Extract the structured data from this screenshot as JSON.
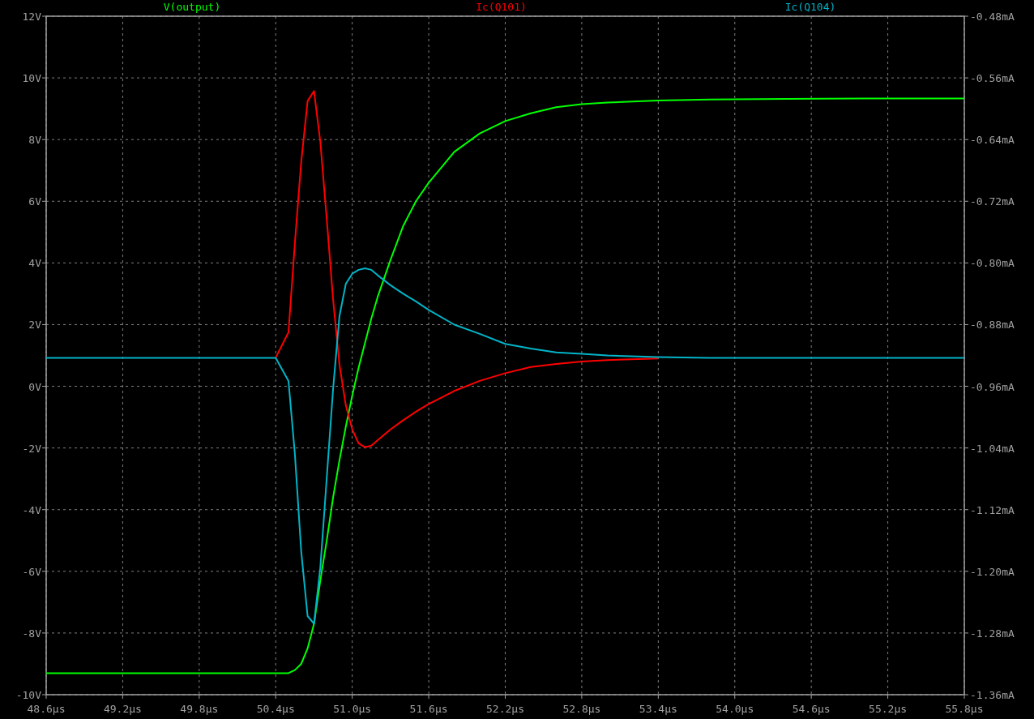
{
  "chart_data": {
    "type": "line",
    "grid": true,
    "x": [
      48.6,
      50.4,
      50.5,
      50.55,
      50.6,
      50.65,
      50.7,
      50.75,
      50.8,
      50.85,
      50.9,
      50.95,
      51.0,
      51.05,
      51.1,
      51.15,
      51.2,
      51.3,
      51.4,
      51.5,
      51.6,
      51.8,
      52.0,
      52.2,
      52.4,
      52.6,
      52.8,
      53.0,
      53.4,
      53.8,
      54.4,
      55.0,
      55.8
    ],
    "xlim": [
      48.6,
      55.8
    ],
    "ylim": [
      -10,
      12
    ],
    "y2lim": [
      -1.36,
      -0.48
    ],
    "xticks": [
      {
        "value": 48.6,
        "label": "48.6µs"
      },
      {
        "value": 49.2,
        "label": "49.2µs"
      },
      {
        "value": 49.8,
        "label": "49.8µs"
      },
      {
        "value": 50.4,
        "label": "50.4µs"
      },
      {
        "value": 51.0,
        "label": "51.0µs"
      },
      {
        "value": 51.6,
        "label": "51.6µs"
      },
      {
        "value": 52.2,
        "label": "52.2µs"
      },
      {
        "value": 52.8,
        "label": "52.8µs"
      },
      {
        "value": 53.4,
        "label": "53.4µs"
      },
      {
        "value": 54.0,
        "label": "54.0µs"
      },
      {
        "value": 54.6,
        "label": "54.6µs"
      },
      {
        "value": 55.2,
        "label": "55.2µs"
      },
      {
        "value": 55.8,
        "label": "55.8µs"
      }
    ],
    "yticks": [
      {
        "value": 12,
        "label": "12V"
      },
      {
        "value": 10,
        "label": "10V"
      },
      {
        "value": 8,
        "label": "8V"
      },
      {
        "value": 6,
        "label": "6V"
      },
      {
        "value": 4,
        "label": "4V"
      },
      {
        "value": 2,
        "label": "2V"
      },
      {
        "value": 0,
        "label": "0V"
      },
      {
        "value": -2,
        "label": "-2V"
      },
      {
        "value": -4,
        "label": "-4V"
      },
      {
        "value": -6,
        "label": "-6V"
      },
      {
        "value": -8,
        "label": "-8V"
      },
      {
        "value": -10,
        "label": "-10V"
      }
    ],
    "y2ticks": [
      {
        "value": -0.48,
        "label": "-0.48mA"
      },
      {
        "value": -0.56,
        "label": "-0.56mA"
      },
      {
        "value": -0.64,
        "label": "-0.64mA"
      },
      {
        "value": -0.72,
        "label": "-0.72mA"
      },
      {
        "value": -0.8,
        "label": "-0.80mA"
      },
      {
        "value": -0.88,
        "label": "-0.88mA"
      },
      {
        "value": -0.96,
        "label": "-0.96mA"
      },
      {
        "value": -1.04,
        "label": "-1.04mA"
      },
      {
        "value": -1.12,
        "label": "-1.12mA"
      },
      {
        "value": -1.2,
        "label": "-1.20mA"
      },
      {
        "value": -1.28,
        "label": "-1.28mA"
      },
      {
        "value": -1.36,
        "label": "-1.36mA"
      }
    ],
    "series": [
      {
        "name": "V(output)",
        "color": "#00ff00",
        "axis": "y",
        "values": [
          -9.3,
          -9.3,
          -9.3,
          -9.2,
          -9.0,
          -8.5,
          -7.7,
          -6.3,
          -5.0,
          -3.6,
          -2.4,
          -1.3,
          -0.3,
          0.6,
          1.4,
          2.2,
          2.9,
          4.1,
          5.2,
          6.0,
          6.6,
          7.6,
          8.2,
          8.6,
          8.85,
          9.05,
          9.15,
          9.2,
          9.27,
          9.3,
          9.32,
          9.33,
          9.33
        ]
      },
      {
        "name": "Ic(Q101)",
        "color": "#ff0000",
        "axis": "y2",
        "values": [
          null,
          -0.923,
          -0.89,
          -0.774,
          -0.669,
          -0.59,
          -0.577,
          -0.643,
          -0.743,
          -0.848,
          -0.932,
          -0.985,
          -1.016,
          -1.034,
          -1.039,
          -1.037,
          -1.03,
          -1.016,
          -1.004,
          -0.993,
          -0.983,
          -0.966,
          -0.953,
          -0.943,
          -0.935,
          -0.931,
          -0.928,
          -0.926,
          -0.924,
          null,
          null,
          null,
          null
        ]
      },
      {
        "name": "Ic(Q104)",
        "color": "#00b4c8",
        "axis": "y2",
        "values": [
          -0.923,
          -0.923,
          -0.953,
          -1.048,
          -1.174,
          -1.258,
          -1.268,
          -1.195,
          -1.079,
          -0.963,
          -0.869,
          -0.827,
          -0.814,
          -0.809,
          -0.807,
          -0.809,
          -0.816,
          -0.829,
          -0.84,
          -0.85,
          -0.861,
          -0.88,
          -0.892,
          -0.905,
          -0.911,
          -0.916,
          -0.918,
          -0.92,
          -0.922,
          -0.923,
          -0.923,
          -0.923,
          -0.923
        ]
      }
    ]
  }
}
